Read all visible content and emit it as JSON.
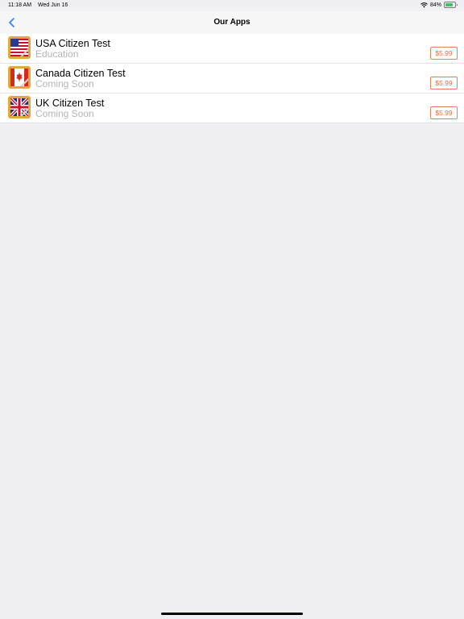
{
  "status": {
    "time": "11:18 AM",
    "date": "Wed Jun 16",
    "battery": "84%"
  },
  "nav": {
    "title": "Our Apps",
    "back_icon": "chevron-left-icon"
  },
  "apps": [
    {
      "title": "USA Citizen Test",
      "subtitle": "Education",
      "price": "$5.99",
      "icon": "us-flag-icon"
    },
    {
      "title": "Canada Citizen Test",
      "subtitle": "Coming Soon",
      "price": "$5.99",
      "icon": "canada-flag-icon"
    },
    {
      "title": "UK Citizen Test",
      "subtitle": "Coming Soon",
      "price": "$5.99",
      "icon": "uk-flag-icon"
    }
  ],
  "colors": {
    "accent": "#2e7cf6",
    "price": "#e26a3f",
    "background": "#efeff4",
    "icon_frame": "#e3a83c"
  }
}
